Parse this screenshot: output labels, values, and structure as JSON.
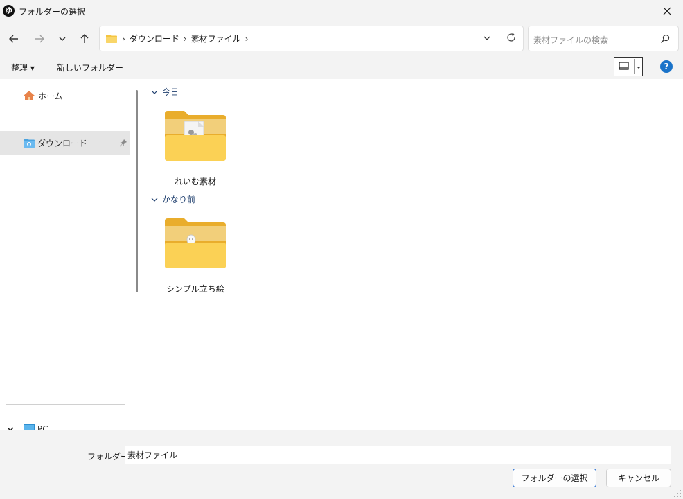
{
  "window": {
    "title": "フォルダーの選択",
    "app_icon_glyph": "ゆ",
    "close_glyph": "✕"
  },
  "nav": {
    "back_icon": "arrow-left-icon",
    "forward_icon": "arrow-right-icon",
    "recent_icon": "chevron-down-icon",
    "up_icon": "arrow-up-icon"
  },
  "address": {
    "crumbs": [
      "ダウンロード",
      "素材ファイル"
    ],
    "separator": "›"
  },
  "search": {
    "placeholder": "素材ファイルの検索"
  },
  "toolbar": {
    "organize": "整理 ▾",
    "new_folder": "新しいフォルダー",
    "help_glyph": "?"
  },
  "sidebar": {
    "items": [
      {
        "label": "ホーム",
        "icon": "home-icon"
      },
      {
        "label": "ダウンロード",
        "icon": "downloads-icon",
        "selected": true,
        "pinned": true
      },
      {
        "label": "PC",
        "icon": "pc-icon"
      }
    ]
  },
  "content": {
    "groups": [
      {
        "header": "今日",
        "folders": [
          {
            "name": "れいむ素材"
          }
        ]
      },
      {
        "header": "かなり前",
        "folders": [
          {
            "name": "シンプル立ち絵"
          }
        ]
      }
    ]
  },
  "footer": {
    "folder_label": "フォルダー:",
    "folder_value": "素材ファイル",
    "select_button": "フォルダーの選択",
    "cancel_button": "キャンセル"
  },
  "colors": {
    "accent": "#3a7bd5",
    "folder_yellow": "#f5c542",
    "selected_bg": "#e5e5e5"
  }
}
